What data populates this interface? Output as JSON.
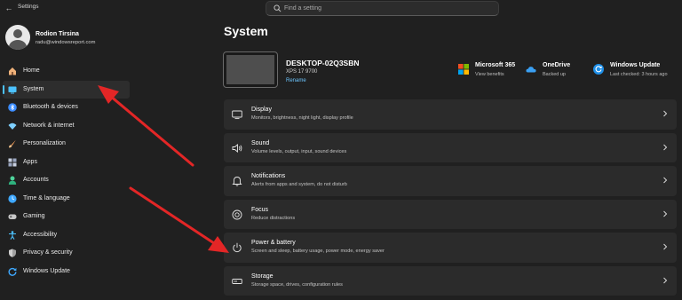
{
  "titlebar": {
    "app_title": "Settings",
    "back_icon": "back-arrow-icon"
  },
  "search": {
    "placeholder": "Find a setting"
  },
  "profile": {
    "name": "Rodion Tirsina",
    "email": "radu@windowsreport.com"
  },
  "sidebar": {
    "items": [
      {
        "label": "Home",
        "icon": "home-icon",
        "color": "#f0b27a"
      },
      {
        "label": "System",
        "icon": "system-icon",
        "color": "#4cc2ff",
        "active": true
      },
      {
        "label": "Bluetooth & devices",
        "icon": "bluetooth-icon",
        "color": "#3b8cff"
      },
      {
        "label": "Network & internet",
        "icon": "wifi-icon",
        "color": "#7ed0ff"
      },
      {
        "label": "Personalization",
        "icon": "brush-icon",
        "color": "#f29b58"
      },
      {
        "label": "Apps",
        "icon": "apps-icon",
        "color": "#9aa6c0"
      },
      {
        "label": "Accounts",
        "icon": "accounts-icon",
        "color": "#4ed39b"
      },
      {
        "label": "Time & language",
        "icon": "globe-clock-icon",
        "color": "#3ea8ff"
      },
      {
        "label": "Gaming",
        "icon": "gamepad-icon",
        "color": "#c8c8c8"
      },
      {
        "label": "Accessibility",
        "icon": "accessibility-icon",
        "color": "#4cc2ff"
      },
      {
        "label": "Privacy & security",
        "icon": "shield-icon",
        "color": "#a0a0a0"
      },
      {
        "label": "Windows Update",
        "icon": "update-icon",
        "color": "#3ea8ff"
      }
    ]
  },
  "main": {
    "title": "System",
    "device": {
      "name": "DESKTOP-02Q3SBN",
      "model": "XPS 17 9700",
      "rename_label": "Rename"
    },
    "tiles": [
      {
        "title": "Microsoft 365",
        "subtitle": "View benefits",
        "icon": "microsoft-365-icon"
      },
      {
        "title": "OneDrive",
        "subtitle": "Backed up",
        "icon": "onedrive-icon"
      },
      {
        "title": "Windows Update",
        "subtitle": "Last checked: 3 hours ago",
        "icon": "windows-update-icon"
      }
    ],
    "cards": [
      {
        "title": "Display",
        "subtitle": "Monitors, brightness, night light, display profile",
        "icon": "display-icon"
      },
      {
        "title": "Sound",
        "subtitle": "Volume levels, output, input, sound devices",
        "icon": "sound-icon"
      },
      {
        "title": "Notifications",
        "subtitle": "Alerts from apps and system, do not disturb",
        "icon": "bell-icon"
      },
      {
        "title": "Focus",
        "subtitle": "Reduce distractions",
        "icon": "focus-icon"
      },
      {
        "title": "Power & battery",
        "subtitle": "Screen and sleep, battery usage, power mode, energy saver",
        "icon": "power-icon"
      },
      {
        "title": "Storage",
        "subtitle": "Storage space, drives, configuration rules",
        "icon": "storage-icon"
      }
    ]
  },
  "colors": {
    "background": "#202020",
    "card": "#2b2b2b",
    "accent": "#4cc2ff",
    "annotation_arrow": "#e32626"
  }
}
